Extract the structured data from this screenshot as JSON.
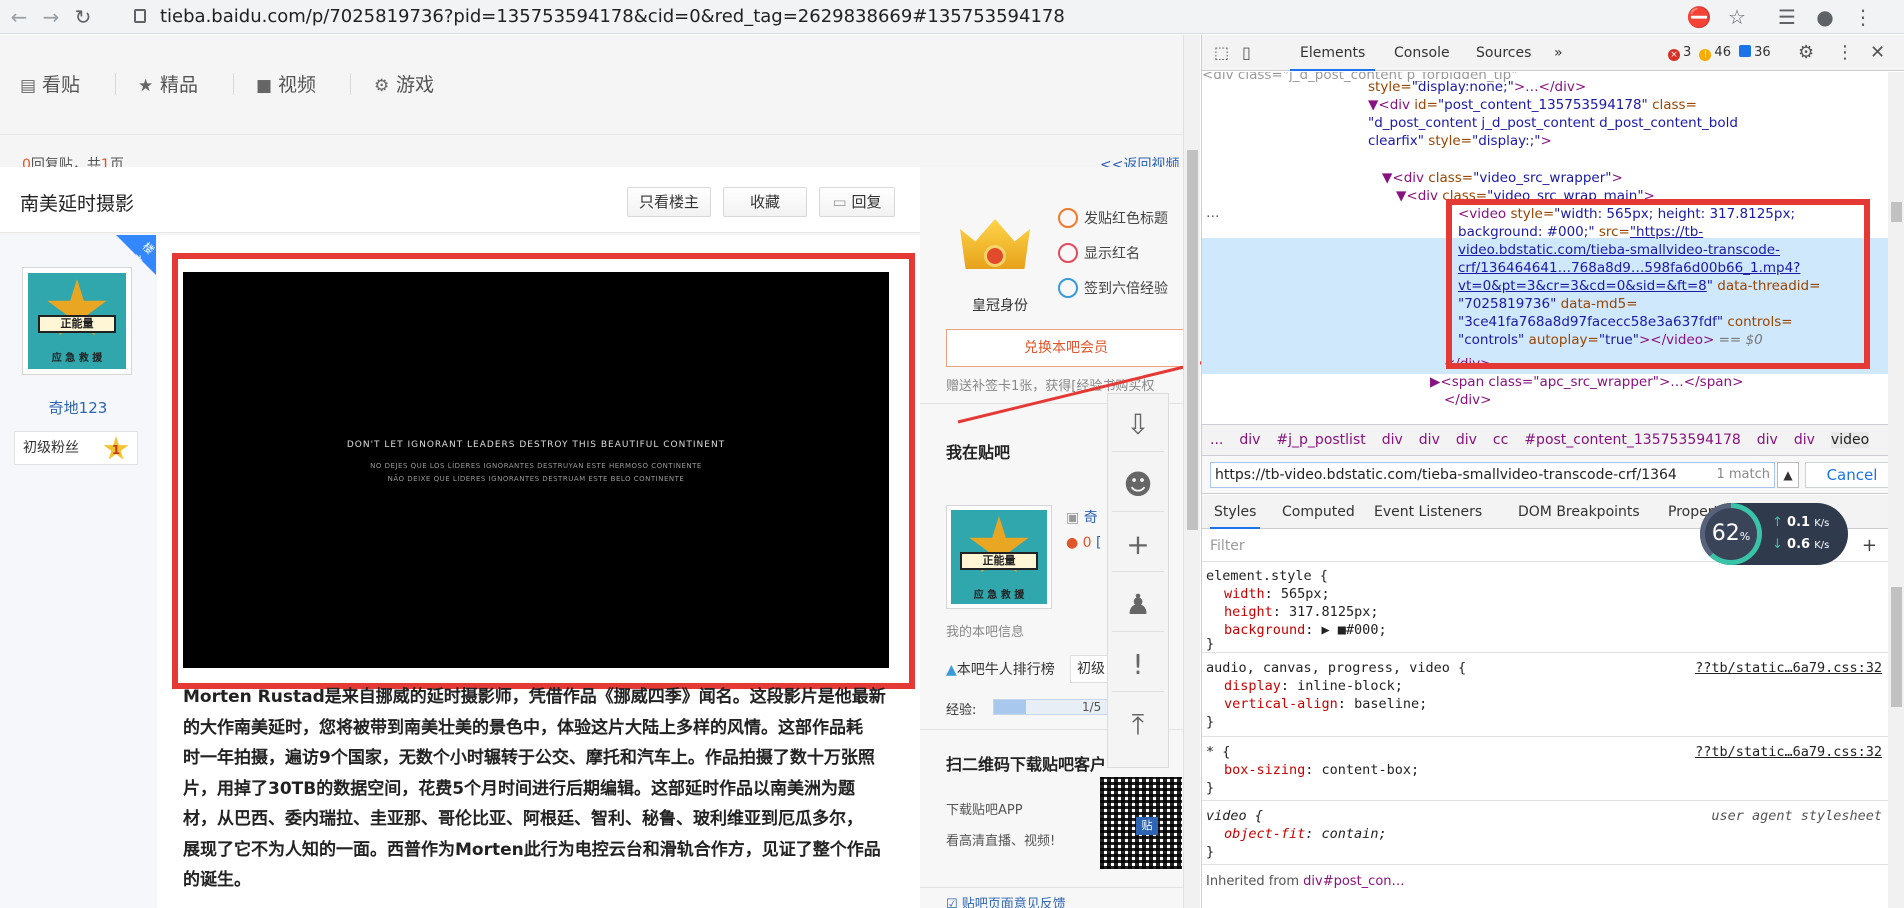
{
  "browser": {
    "url": "tieba.baidu.com/p/7025819736?pid=135753594178&cid=0&red_tag=2629838669#135753594178"
  },
  "page": {
    "nav_tabs": [
      {
        "label": "看贴",
        "icon": "list-icon"
      },
      {
        "label": "精品",
        "icon": "star-icon"
      },
      {
        "label": "视频",
        "icon": "video-camera-icon"
      },
      {
        "label": "游戏",
        "icon": "gamepad-icon"
      }
    ],
    "reply_count": "0",
    "reply_text_mid": "回复贴，共",
    "page_count": "1",
    "reply_text_end": "页",
    "back_link": "<<返回视频",
    "thread_title": "南美延时摄影",
    "btn_only_op": "只看楼主",
    "btn_favorite": "收藏",
    "btn_reply": "回复",
    "op_tag": "楼主",
    "avatar_badge_text": "正能量",
    "avatar_badge_sub": "应 急 救 援",
    "username": "奇地123",
    "fan_level_label": "初级粉丝",
    "fan_level": "1",
    "video_caption_1": "DON'T LET IGNORANT LEADERS DESTROY THIS BEAUTIFUL CONTINENT",
    "video_caption_2": "NO DEJES QUE LOS LÍDERES IGNORANTES DESTRUYAN ESTE HERMOSO CONTINENTE",
    "video_caption_3": "NÃO DEIXE QUE LÍDERES IGNORANTES DESTRUAM ESTE BELO CONTINENTE",
    "post_lines": [
      "Morten Rustad是来自挪威的延时摄影师，凭借作品《挪威四季》闻名。这段影片是他最新",
      "的大作南美延时，您将被带到南美壮美的景色中，体验这片大陆上多样的风情。这部作品耗",
      "时一年拍摄，遍访9个国家，无数个小时辗转于公交、摩托和汽车上。作品拍摄了数十万张照",
      "片，用掉了30TB的数据空间，花费5个月时间进行后期编辑。这部延时作品以南美洲为题",
      "材，从巴西、委内瑞拉、圭亚那、哥伦比亚、阿根廷、智利、秘鲁、玻利维亚到厄瓜多尔，",
      "展现了它不为人知的一面。西普作为Morten此行为电控云台和滑轨合作方，见证了整个作品",
      "的诞生。"
    ],
    "sidebar": {
      "crown_label": "皇冠身份",
      "perk_1": "发贴红色标题",
      "perk_2": "显示红名",
      "perk_3": "签到六倍经验",
      "exchange_btn": "兑换本吧会员",
      "gift_text": "赠送补签卡1张，获得[经验书购买权",
      "my_tieba": "我在贴吧",
      "my_name": "奇",
      "my_coin": "0",
      "my_info": "我的本吧信息",
      "rank_link": "本吧牛人排行榜",
      "rank_level": "初级",
      "exp_label": "经验:",
      "exp_value": "1/5",
      "exp_progress": 0.2,
      "qr_title": "扫二维码下载贴吧客户",
      "download_app": "下载贴吧APP",
      "download_desc": "看高清直播、视频!",
      "qr_tag": "贴",
      "feedback": "贴吧页面意见反馈"
    },
    "float_bar": [
      "download-icon",
      "bear-icon",
      "plus-icon",
      "user-icon",
      "report-icon",
      "back-to-top-icon"
    ]
  },
  "devtools": {
    "tabs": [
      "Elements",
      "Console",
      "Sources",
      "»"
    ],
    "errors": "3",
    "warnings": "46",
    "messages": "36",
    "tree": [
      {
        "indent": 0,
        "text_tag": "style=",
        "text_val": "\"display:none;\"",
        "tail": ">…</div>"
      },
      {
        "indent": 0,
        "text_tag": "▼<div ",
        "text_attr": "id=",
        "text_val": "\"post_content_135753594178\"",
        "tail": " class="
      },
      {
        "indent": 0,
        "text_val": "\"d_post_content j_d_post_content d_post_content_bold"
      },
      {
        "indent": 0,
        "text_val": "clearfix\"",
        "text_attr": " style=",
        "text_val2": "\"display:;\"",
        "tail": ">"
      },
      {
        "indent": 1,
        "text_tag": "▼<div ",
        "text_attr": "class=",
        "text_val": "\"video_src_wrapper\"",
        "tail": ">"
      },
      {
        "indent": 2,
        "text_tag": "▼<div ",
        "text_attr": "class=",
        "text_val": "\"video_src_wrap_main\"",
        "tail": ">"
      }
    ],
    "video_node": {
      "line1_tag": "<video ",
      "line1_attr": "style=",
      "line1_val": "\"width: 565px; height: 317.8125px;",
      "line2_val": "background: #000;\"",
      "line2_attr": " src=",
      "line2_link": "\"https://tb-",
      "line3_link": "video.bdstatic.com/tieba-smallvideo-transcode-",
      "line4_link": "crf/136464641…768a8d9…598fa6d00b66_1.mp4?",
      "line5_link": "vt=0&pt=3&cr=3&cd=0&sid=&ft=8",
      "line5_tail": "\"",
      "line5_attr": " data-threadid=",
      "line6_val": "\"7025819736\"",
      "line6_attr": " data-md5=",
      "line7_val": "\"3ce41fa768a8d97facecc58e3a637fdf\"",
      "line7_attr": " controls=",
      "line8_val": "\"controls\"",
      "line8_attr": " autoplay=",
      "line8_val2": "\"true\"",
      "line8_tail": "></video>",
      "line8_eq": " == $0"
    },
    "after_lines": [
      "</div>",
      "▶<span class=\"apc_src_wrapper\">…</span>",
      "</div>"
    ],
    "breadcrumb": [
      "...",
      "div",
      "#j_p_postlist",
      "div",
      "div",
      "div",
      "cc",
      "#post_content_135753594178",
      "div",
      "div",
      "video"
    ],
    "search_value": "https://tb-video.bdstatic.com/tieba-smallvideo-transcode-crf/1364",
    "search_match": "1 match",
    "cancel": "Cancel",
    "style_tabs": [
      "Styles",
      "Computed",
      "Event Listeners",
      "DOM Breakpoints",
      "Properties"
    ],
    "filter_placeholder": "Filter",
    "rules": [
      {
        "selector": "element.style {",
        "props": [
          [
            "width",
            "565px;"
          ],
          [
            "height",
            "317.8125px;"
          ],
          [
            "background",
            "▶ ■#000;"
          ]
        ],
        "source": ""
      },
      {
        "selector": "audio, canvas, progress, video {",
        "props": [
          [
            "display",
            "inline-block;"
          ],
          [
            "vertical-align",
            "baseline;"
          ]
        ],
        "source": "??tb/static…6a79.css:32"
      },
      {
        "selector": "* {",
        "props": [
          [
            "box-sizing",
            "content-box;"
          ]
        ],
        "source": "??tb/static…6a79.css:32"
      },
      {
        "selector": "video {",
        "props": [
          [
            "object-fit",
            "contain;"
          ]
        ],
        "source": "user agent stylesheet"
      }
    ],
    "inherited_label": "Inherited from ",
    "inherited_node": "div#post_con…"
  },
  "perf_widget": {
    "percent": "62",
    "unit": "%",
    "up": "0.1",
    "up_unit": "K/s",
    "down": "0.6",
    "down_unit": "K/s",
    "level": 0.62
  }
}
